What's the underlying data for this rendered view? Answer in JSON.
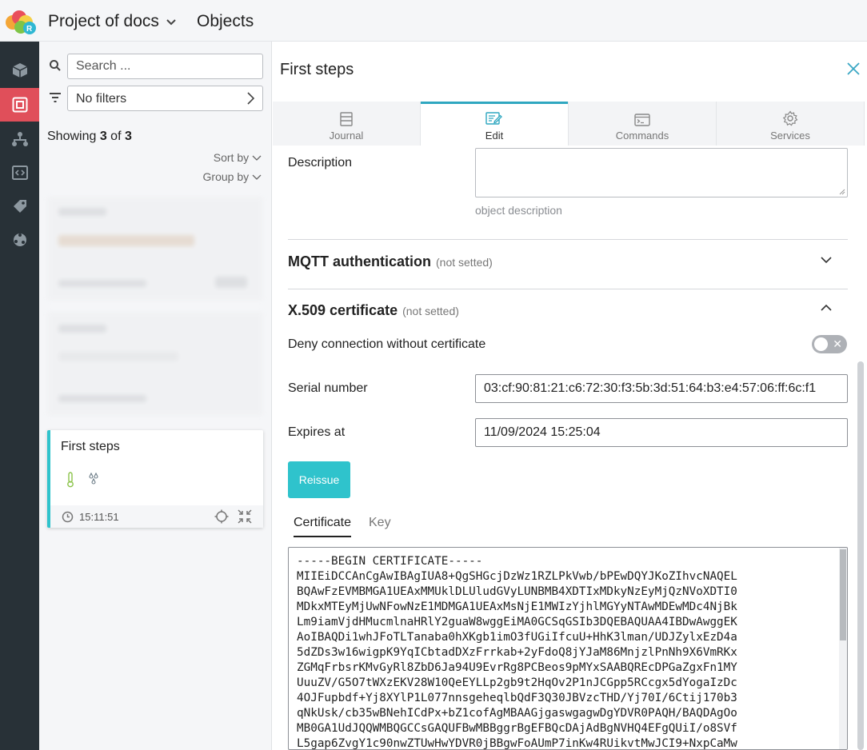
{
  "header": {
    "project_title": "Project of docs",
    "section_title": "Objects"
  },
  "rail": {
    "items": [
      {
        "icon": "cube-icon",
        "active": false
      },
      {
        "icon": "objects-icon",
        "active": true
      },
      {
        "icon": "hierarchy-icon",
        "active": false
      },
      {
        "icon": "code-icon",
        "active": false
      },
      {
        "icon": "tag-icon",
        "active": false
      },
      {
        "icon": "globe-network-icon",
        "active": false
      }
    ]
  },
  "list": {
    "search_placeholder": "Search ...",
    "filter_label": "No filters",
    "showing_prefix": "Showing ",
    "showing_count": "3",
    "showing_mid": " of ",
    "showing_total": "3",
    "sort_by": "Sort by",
    "group_by": "Group by",
    "selected_card": {
      "title": "First steps",
      "time": "15:11:51"
    }
  },
  "detail": {
    "title": "First steps",
    "tabs": [
      {
        "label": "Journal",
        "icon": "journal-icon"
      },
      {
        "label": "Edit",
        "icon": "edit-icon",
        "active": true
      },
      {
        "label": "Commands",
        "icon": "terminal-icon"
      },
      {
        "label": "Services",
        "icon": "gear-icon"
      }
    ],
    "description_label": "Description",
    "description_value": "",
    "description_hint": "object description",
    "mqtt_title": "MQTT authentication",
    "mqtt_status": "(not setted)",
    "x509_title": "X.509 certificate",
    "x509_status": "(not setted)",
    "deny_label": "Deny connection without certificate",
    "deny_enabled": false,
    "serial_label": "Serial number",
    "serial_value": "03:cf:90:81:21:c6:72:30:f3:5b:3d:51:64:b3:e4:57:06:ff:6c:f1",
    "expires_label": "Expires at",
    "expires_value": "11/09/2024 15:25:04",
    "reissue_label": "Reissue",
    "cert_tab": "Certificate",
    "key_tab": "Key",
    "certificate_text": "-----BEGIN CERTIFICATE-----\nMIIEiDCCAnCgAwIBAgIUA8+QgSHGcjDzWz1RZLPkVwb/bPEwDQYJKoZIhvcNAQEL\nBQAwFzEVMBMGA1UEAxMMUklDLUludGVyLUNBMB4XDTIxMDkyNzEyMjQzNVoXDTI0\nMDkxMTEyMjUwNFowNzE1MDMGA1UEAxMsNjE1MWIzYjhlMGYyNTAwMDEwMDc4NjBk\nLm9iamVjdHMucmlnaHRlY2guaW8wggEiMA0GCSqGSIb3DQEBAQUAA4IBDwAwggEK\nAoIBAQDi1whJFoTLTanaba0hXKgb1imO3fUGiIfcuU+HhK3lman/UDJZylxEzD4a\n5dZDs3w16wigpK9YqICbtadDXzFrrkab+2yFdoQ8jYJaM86MnjzlPnNh9X6VmRKx\nZGMqFrbsrKMvGyRl8ZbD6Ja94U9EvrRg8PCBeos9pMYxSAABQREcDPGaZgxFn1MY\nUuuZV/G5O7tWXzEKV28W10QeEYLLp2gb9t2HqOv2P1nJCGpp5RCcgx5dYogaIzDc\n4OJFupbdf+Yj8XYlP1L077nnsgeheqlbQdF3Q30JBVzcTHD/Yj70I/6Ctij170b3\nqNkUsk/cb35wBNehICdPx+bZ1cofAgMBAAGjgaswgagwDgYDVR0PAQH/BAQDAgOo\nMB0GA1UdJQQWMBQGCCsGAQUFBwMBBggrBgEFBQcDAjAdBgNVHQ4EFgQUiI/o8SVf\nL5gap6ZvgY1c90nwZTUwHwYDVR0jBBgwFoAUmP7inKw4RUikvtMwJCI9+NxpCaMw"
  },
  "colors": {
    "accent": "#2fc3cc",
    "rail_bg": "#283137",
    "rail_active": "#e04f5a",
    "tab_active_line": "#2fa7c0"
  }
}
